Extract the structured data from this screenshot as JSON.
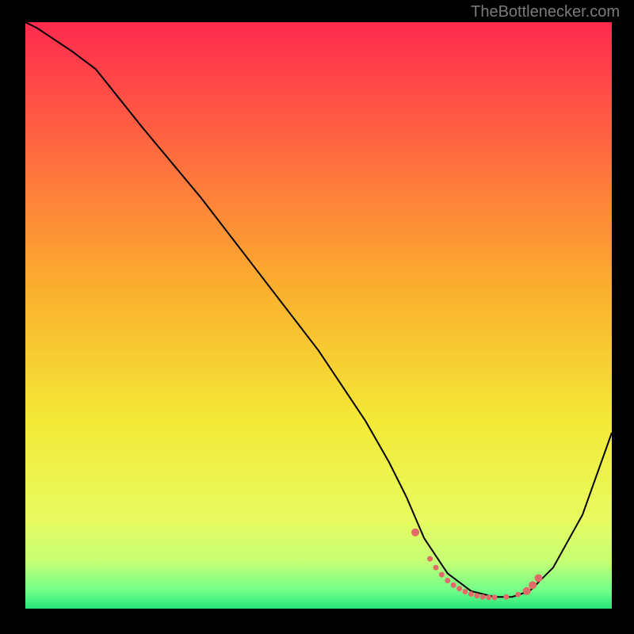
{
  "watermark": "TheBottlenecker.com",
  "chart_data": {
    "type": "line",
    "title": "",
    "xlabel": "",
    "ylabel": "",
    "xlim": [
      0,
      100
    ],
    "ylim": [
      0,
      100
    ],
    "background_gradient": {
      "stops": [
        {
          "pos": 0.0,
          "color": "#ff2a4e"
        },
        {
          "pos": 0.22,
          "color": "#ff6a40"
        },
        {
          "pos": 0.45,
          "color": "#fbae2e"
        },
        {
          "pos": 0.68,
          "color": "#f4e936"
        },
        {
          "pos": 0.85,
          "color": "#e7fb60"
        },
        {
          "pos": 0.92,
          "color": "#c4ff75"
        },
        {
          "pos": 0.97,
          "color": "#6fff8a"
        },
        {
          "pos": 1.0,
          "color": "#26e47a"
        }
      ]
    },
    "series": [
      {
        "name": "bottleneck-curve",
        "color": "#000000",
        "width": 2,
        "x": [
          0,
          2,
          5,
          8,
          12,
          20,
          30,
          40,
          50,
          58,
          62,
          65,
          68,
          72,
          76,
          80,
          83,
          86,
          90,
          95,
          100
        ],
        "y": [
          100,
          99,
          97,
          95,
          92,
          82,
          70,
          57,
          44,
          32,
          25,
          19,
          12,
          6,
          3,
          2,
          2,
          3,
          7,
          16,
          30
        ]
      }
    ],
    "markers": {
      "name": "bottleneck-optimal-zone",
      "color": "#e46a6a",
      "size_small": 3.5,
      "size_large": 5,
      "points": [
        {
          "x": 66.5,
          "y": 13.0,
          "r": "large"
        },
        {
          "x": 69.0,
          "y": 8.5,
          "r": "small"
        },
        {
          "x": 70.0,
          "y": 7.0,
          "r": "small"
        },
        {
          "x": 71.0,
          "y": 5.8,
          "r": "small"
        },
        {
          "x": 72.0,
          "y": 4.8,
          "r": "small"
        },
        {
          "x": 73.0,
          "y": 4.0,
          "r": "small"
        },
        {
          "x": 74.0,
          "y": 3.4,
          "r": "small"
        },
        {
          "x": 75.0,
          "y": 2.9,
          "r": "small"
        },
        {
          "x": 76.0,
          "y": 2.5,
          "r": "small"
        },
        {
          "x": 77.0,
          "y": 2.2,
          "r": "small"
        },
        {
          "x": 78.0,
          "y": 2.0,
          "r": "small"
        },
        {
          "x": 79.0,
          "y": 1.9,
          "r": "small"
        },
        {
          "x": 80.0,
          "y": 1.9,
          "r": "small"
        },
        {
          "x": 82.0,
          "y": 2.0,
          "r": "small"
        },
        {
          "x": 84.0,
          "y": 2.4,
          "r": "small"
        },
        {
          "x": 85.5,
          "y": 3.0,
          "r": "large"
        },
        {
          "x": 86.5,
          "y": 4.0,
          "r": "large"
        },
        {
          "x": 87.5,
          "y": 5.2,
          "r": "large"
        }
      ]
    }
  }
}
